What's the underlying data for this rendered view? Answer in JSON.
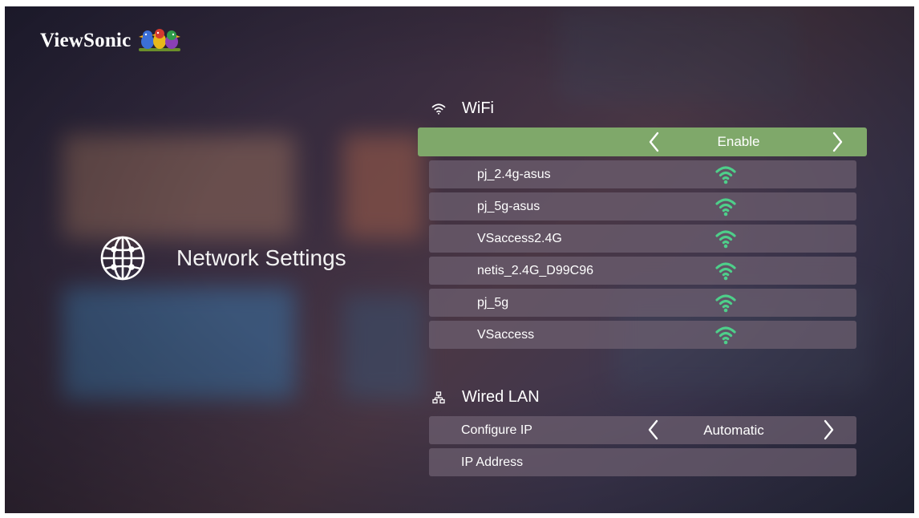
{
  "brand": {
    "name": "ViewSonic",
    "logo_icon": "birds-logo-icon"
  },
  "page": {
    "title": "Network Settings",
    "icon": "globe-icon"
  },
  "wifi": {
    "section_label": "WiFi",
    "icon": "wifi-icon",
    "toggle_value": "Enable",
    "networks": [
      {
        "ssid": "pj_2.4g-asus",
        "signal_icon": "wifi-signal-icon"
      },
      {
        "ssid": "pj_5g-asus",
        "signal_icon": "wifi-signal-icon"
      },
      {
        "ssid": "VSaccess2.4G",
        "signal_icon": "wifi-signal-icon"
      },
      {
        "ssid": "netis_2.4G_D99C96",
        "signal_icon": "wifi-signal-icon"
      },
      {
        "ssid": "pj_5g",
        "signal_icon": "wifi-signal-icon"
      },
      {
        "ssid": "VSaccess",
        "signal_icon": "wifi-signal-icon"
      }
    ]
  },
  "wired_lan": {
    "section_label": "Wired LAN",
    "icon": "network-icon",
    "configure_ip_label": "Configure IP",
    "configure_ip_value": "Automatic",
    "ip_address_label": "IP Address"
  },
  "colors": {
    "highlight": "#7fa86a",
    "signal": "#4ecf8a",
    "row_bg": "#6e5f70"
  }
}
